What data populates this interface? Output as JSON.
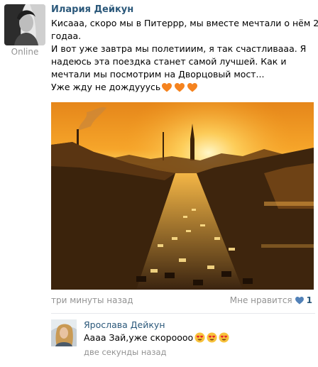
{
  "post": {
    "author": "Илария Дейкун",
    "status": "Online",
    "text_lines": [
      "Кисааа, скоро мы в Питеррр, мы вместе мечтали о нём 2",
      "годаа.",
      "И вот уже завтра мы полетииим, я так счастливааа. Я",
      "надеюсь эта поездка станет самой лучшей. Как и",
      "мечтали мы посмотрим на Дворцовый мост...",
      "Уже жду не дождууусь"
    ],
    "hearts": [
      "orange-heart-icon",
      "orange-heart-icon",
      "orange-heart-icon"
    ],
    "time": "три минуты назад",
    "like_label": "Мне нравится",
    "like_count": "1"
  },
  "comment": {
    "author": "Ярослава Дейкун",
    "text": "Аааа Зай,уже скороооо",
    "emojis": [
      "heart-eyes-emoji",
      "heart-eyes-emoji",
      "heart-eyes-emoji"
    ],
    "time": "две секунды назад"
  },
  "colors": {
    "link": "#2b587a",
    "muted": "#939393",
    "sunset_orange": "#f29a1f"
  }
}
